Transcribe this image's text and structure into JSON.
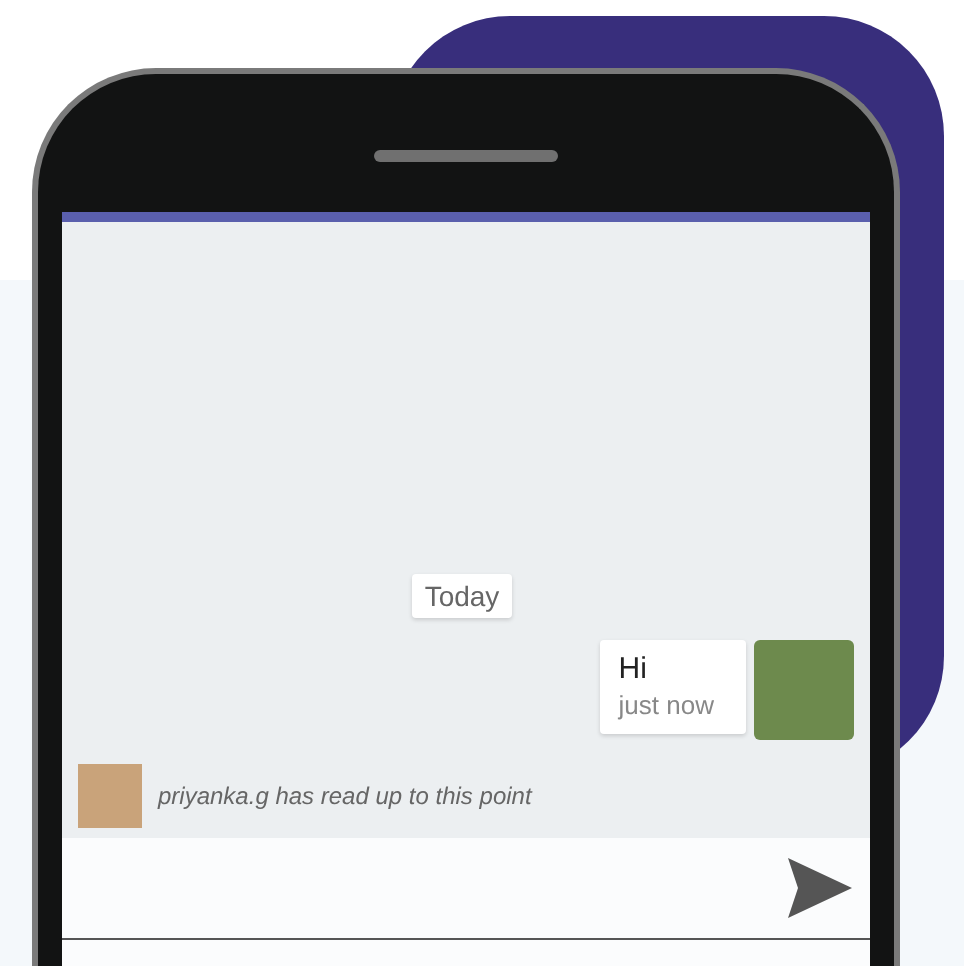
{
  "chat": {
    "date_chip": "Today",
    "messages": [
      {
        "text": "Hi",
        "time": "just now"
      }
    ],
    "read_receipt": {
      "text": "priyanka.g has read up to this point"
    }
  }
}
